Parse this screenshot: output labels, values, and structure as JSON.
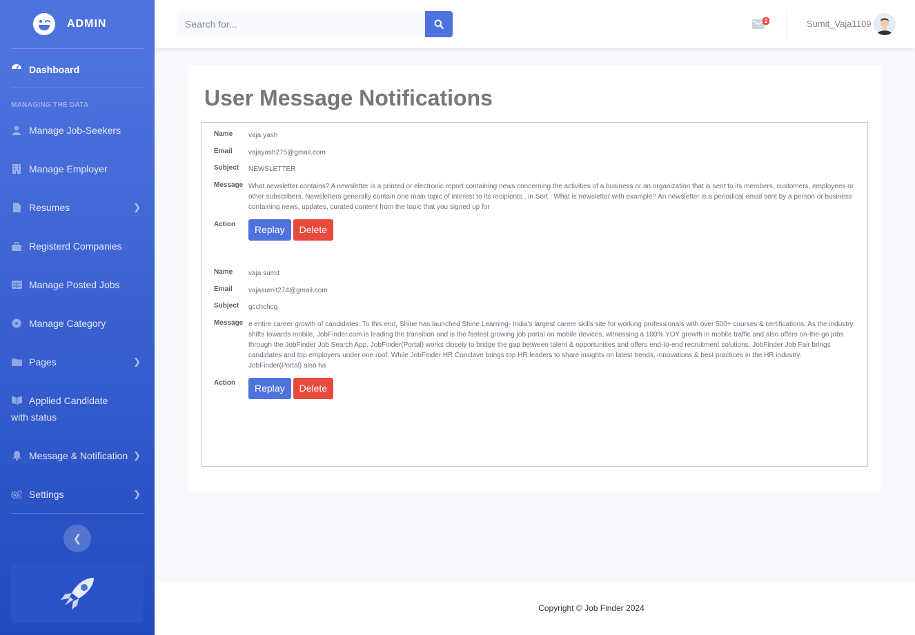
{
  "brand": {
    "name": "ADMIN"
  },
  "sidebar": {
    "dashboard": "Dashboard",
    "heading": "MANAGING THE DATA",
    "items": [
      {
        "label": "Manage Job-Seekers",
        "icon": "user-icon",
        "chevron": false
      },
      {
        "label": "Manage Employer",
        "icon": "building-icon",
        "chevron": false
      },
      {
        "label": "Resumes",
        "icon": "file-icon",
        "chevron": true
      },
      {
        "label": "Registerd Companies",
        "icon": "briefcase-icon",
        "chevron": false
      },
      {
        "label": "Manage Posted Jobs",
        "icon": "table-icon",
        "chevron": false
      },
      {
        "label": "Manage Category",
        "icon": "circle-icon",
        "chevron": false
      },
      {
        "label": "Pages",
        "icon": "folder-icon",
        "chevron": true
      },
      {
        "label": "Applied Candidate with status",
        "icon": "book-icon",
        "chevron": false
      },
      {
        "label": "Message & Notification",
        "icon": "bell-icon",
        "chevron": true
      },
      {
        "label": "Settings",
        "icon": "cogs-icon",
        "chevron": true
      }
    ]
  },
  "search": {
    "placeholder": "Search for..."
  },
  "topbar": {
    "mail_count": "2",
    "username": "Sumit_Vaja1109"
  },
  "page": {
    "title": "User Message Notifications"
  },
  "labels": {
    "name": "Name",
    "email": "Email",
    "subject": "Subject",
    "message": "Message",
    "action": "Action",
    "replay": "Replay",
    "delete": "Delete"
  },
  "messages": [
    {
      "name": "vaja yash",
      "email": "vajayash275@gmail.com",
      "subject": "NEWSLETTER",
      "message": "What newsletter contains? A newsletter is a printed or electronic report containing news concerning the activities of a business or an organization that is sent to its members, customers, employees or other subscribers. Newsletters generally contain one main topic of interest to its recipients , in Sort : What is newsletter with example? An newsletter is a periodical email sent by a person or business containing news, updates, curated content from the topic that you signed up for"
    },
    {
      "name": "vaja sumit",
      "email": "vajasumit274@gmail.com",
      "subject": "gcchchcg",
      "message": "e entire career growth of candidates. To this end, Shine has launched Shine Learning- India's largest career skills site for working professionals with over 500+ courses & certifications. As the industry shifts towards mobile, JobFinder.com is leading the transition and is the fastest growing job portal on mobile devices, witnessing a 100% YOY growth in mobile traffic and also offers on-the-go jobs through the JobFinder Job Search App. JobFinder(Portal) works closely to bridge the gap between talent & opportunities and offers end-to-end recruitment solutions. JobFinder Job Fair brings candidates and top employers under one roof. While JobFinder HR Conclave brings top HR leaders to share insights on latest trends, innovations & best practices in the HR industry. JobFinder(Portal) also ha"
    }
  ],
  "footer": {
    "copyright": "Copyright © Job Finder 2024"
  },
  "colors": {
    "primary": "#4e73df",
    "danger": "#e74a3b",
    "sidebar_end": "#224abe"
  }
}
